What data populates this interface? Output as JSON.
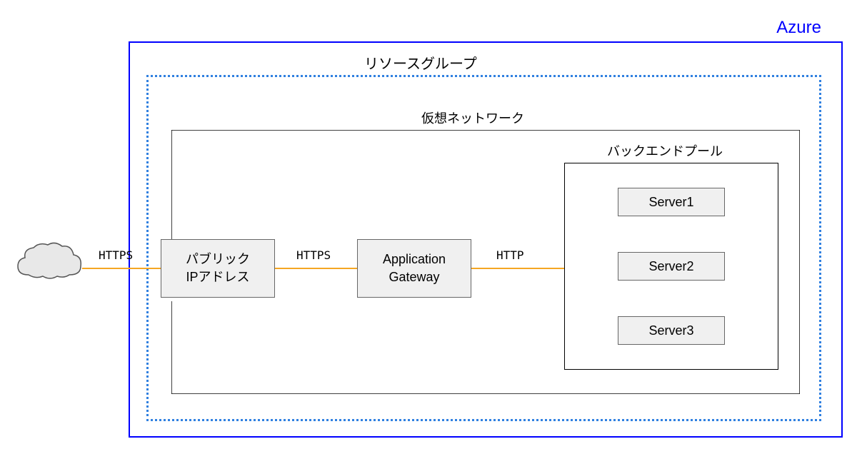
{
  "azure": {
    "label": "Azure"
  },
  "resource_group": {
    "label": "リソースグループ"
  },
  "vnet": {
    "label": "仮想ネットワーク"
  },
  "backend_pool": {
    "label": "バックエンドプール"
  },
  "nodes": {
    "public_ip": "パブリック\nIPアドレス",
    "app_gateway": "Application\nGateway",
    "server1": "Server1",
    "server2": "Server2",
    "server3": "Server3"
  },
  "connections": {
    "cloud_to_pip": "HTTPS",
    "pip_to_appgw": "HTTPS",
    "appgw_to_backend": "HTTP"
  }
}
